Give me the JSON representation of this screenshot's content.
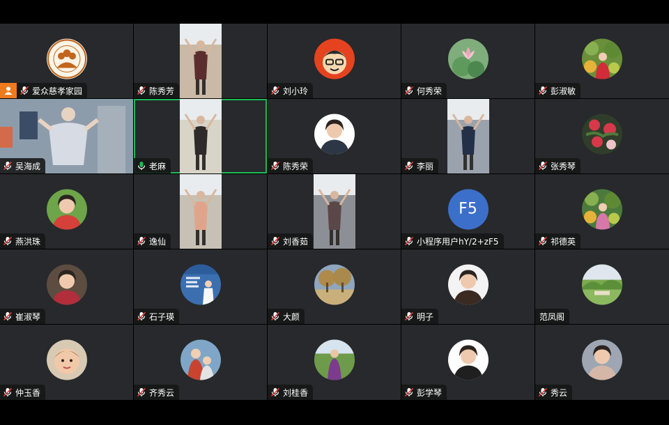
{
  "participants": [
    {
      "name": "爱众慈孝家园",
      "mic": "muted",
      "host": true,
      "view": "avatar",
      "icon": "org-logo-icon",
      "bg": "#f3e7d0",
      "fg": "#c2651e"
    },
    {
      "name": "陈秀芳",
      "mic": "muted",
      "view": "video",
      "bg": "#c9b9a6",
      "fg": "#5b2e2e"
    },
    {
      "name": "刘小玲",
      "mic": "muted",
      "view": "avatar",
      "icon": "cartoon-face-icon",
      "bg": "#e5431f",
      "fg": "#f5d3a3"
    },
    {
      "name": "何秀荣",
      "mic": "muted",
      "view": "avatar",
      "icon": "lotus-photo-icon",
      "bg": "#7fae7c",
      "fg": "#e8a7b7"
    },
    {
      "name": "彭淑敏",
      "mic": "muted",
      "view": "avatar",
      "icon": "garden-photo-icon",
      "bg": "#6a8f3a",
      "fg": "#d12c3a"
    },
    {
      "name": "吴海成",
      "mic": "muted",
      "view": "video-wide",
      "bg": "#8d9cab",
      "fg": "#d7dbe4"
    },
    {
      "name": "老麻",
      "mic": "active",
      "view": "video",
      "active": true,
      "bg": "#d8d4c7",
      "fg": "#2e2a2a"
    },
    {
      "name": "陈秀荣",
      "mic": "muted",
      "view": "avatar",
      "icon": "portrait-photo-icon",
      "bg": "#ffffff",
      "fg": "#2d3644"
    },
    {
      "name": "李丽",
      "mic": "muted",
      "view": "video",
      "bg": "#9aa3ad",
      "fg": "#243047"
    },
    {
      "name": "张秀琴",
      "mic": "muted",
      "view": "avatar",
      "icon": "flower-photo-icon",
      "bg": "#2f3d2a",
      "fg": "#d7384a"
    },
    {
      "name": "燕洪珠",
      "mic": "muted",
      "view": "avatar",
      "icon": "portrait-photo-icon",
      "bg": "#6ea44a",
      "fg": "#d5403a"
    },
    {
      "name": "逸仙",
      "mic": "muted",
      "view": "video",
      "bg": "#c6c1b4",
      "fg": "#e0a48c"
    },
    {
      "name": "刘香茹",
      "mic": "muted",
      "view": "video",
      "bg": "#8c8f95",
      "fg": "#5a4848"
    },
    {
      "name": "小程序用户hY/2+zF5",
      "mic": "muted",
      "view": "letter",
      "letter": "F5",
      "bg": "#3c6fc9",
      "fg": "#ffffff"
    },
    {
      "name": "祁德英",
      "mic": "muted",
      "view": "avatar",
      "icon": "garden-photo-icon",
      "bg": "#4c7a3c",
      "fg": "#d678a8"
    },
    {
      "name": "崔淑琴",
      "mic": "muted",
      "view": "avatar",
      "icon": "portrait-photo-icon",
      "bg": "#5d4c40",
      "fg": "#b22e3a"
    },
    {
      "name": "石子瑛",
      "mic": "muted",
      "view": "avatar",
      "icon": "poster-photo-icon",
      "bg": "#3b6fb0",
      "fg": "#e8eef7"
    },
    {
      "name": "大颜",
      "mic": "muted",
      "view": "avatar",
      "icon": "tree-photo-icon",
      "bg": "#8fa6bf",
      "fg": "#b08a4a"
    },
    {
      "name": "明子",
      "mic": "muted",
      "view": "avatar",
      "icon": "portrait-photo-icon",
      "bg": "#f3f3f3",
      "fg": "#3a2a22"
    },
    {
      "name": "范凤阁",
      "mic": "none",
      "view": "avatar",
      "icon": "park-photo-icon",
      "bg": "#7aa84e",
      "fg": "#e6e0c8"
    },
    {
      "name": "仲玉香",
      "mic": "muted",
      "view": "avatar",
      "icon": "child-photo-icon",
      "bg": "#d8c9b3",
      "fg": "#f2c9a8"
    },
    {
      "name": "齐秀云",
      "mic": "muted",
      "view": "avatar",
      "icon": "family-photo-icon",
      "bg": "#7fa6c6",
      "fg": "#c9432f"
    },
    {
      "name": "刘桂香",
      "mic": "muted",
      "view": "avatar",
      "icon": "outdoor-photo-icon",
      "bg": "#6d9b4a",
      "fg": "#7b3c8e"
    },
    {
      "name": "彭学琴",
      "mic": "muted",
      "view": "avatar",
      "icon": "portrait-photo-icon",
      "bg": "#ffffff",
      "fg": "#1f1f1f"
    },
    {
      "name": "秀云",
      "mic": "muted",
      "view": "avatar",
      "icon": "portrait-photo-icon",
      "bg": "#9da6b2",
      "fg": "#d4b7a7"
    }
  ],
  "colors": {
    "tile_bg": "#27292c",
    "active_border": "#1fba55",
    "host_badge": "#f07b1f",
    "mic_muted_red": "#e03b3b",
    "mic_active_green": "#1fba55"
  }
}
